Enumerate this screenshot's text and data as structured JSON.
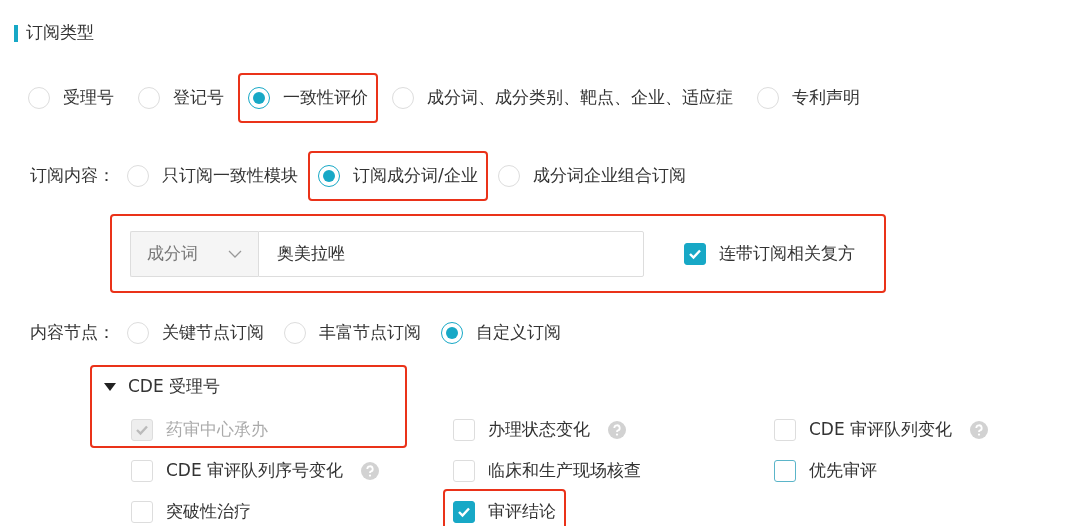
{
  "section_title": "订阅类型",
  "subscription_types": [
    {
      "label": "受理号",
      "selected": false,
      "highlighted": false
    },
    {
      "label": "登记号",
      "selected": false,
      "highlighted": false
    },
    {
      "label": "一致性评价",
      "selected": true,
      "highlighted": true
    },
    {
      "label": "成分词、成分类别、靶点、企业、适应症",
      "selected": false,
      "highlighted": false
    },
    {
      "label": "专利声明",
      "selected": false,
      "highlighted": false
    }
  ],
  "content": {
    "label": "订阅内容：",
    "options": [
      {
        "label": "只订阅一致性模块",
        "selected": false,
        "highlighted": false
      },
      {
        "label": "订阅成分词/企业",
        "selected": true,
        "highlighted": true
      },
      {
        "label": "成分词企业组合订阅",
        "selected": false,
        "highlighted": false
      }
    ]
  },
  "filter": {
    "highlighted": true,
    "field_type": "成分词",
    "value": "奥美拉唑",
    "include_compounds": {
      "label": "连带订阅相关复方",
      "checked": true
    }
  },
  "nodes": {
    "label": "内容节点：",
    "options": [
      {
        "label": "关键节点订阅",
        "selected": false
      },
      {
        "label": "丰富节点订阅",
        "selected": false
      },
      {
        "label": "自定义订阅",
        "selected": true
      }
    ]
  },
  "tree": {
    "label": "CDE 受理号",
    "expanded": true,
    "highlighted": true,
    "children": [
      {
        "label": "药审中心承办",
        "checked": true,
        "disabled": true,
        "help": false,
        "focused": false,
        "highlighted": false
      },
      {
        "label": "办理状态变化",
        "checked": false,
        "disabled": false,
        "help": true,
        "focused": false,
        "highlighted": false
      },
      {
        "label": "CDE 审评队列变化",
        "checked": false,
        "disabled": false,
        "help": true,
        "focused": false,
        "highlighted": false
      },
      {
        "label": "CDE 审评队列序号变化",
        "checked": false,
        "disabled": false,
        "help": true,
        "focused": false,
        "highlighted": false
      },
      {
        "label": "临床和生产现场核查",
        "checked": false,
        "disabled": false,
        "help": false,
        "focused": false,
        "highlighted": false
      },
      {
        "label": "优先审评",
        "checked": false,
        "disabled": false,
        "help": false,
        "focused": true,
        "highlighted": false
      },
      {
        "label": "突破性治疗",
        "checked": false,
        "disabled": false,
        "help": false,
        "focused": false,
        "highlighted": false
      },
      {
        "label": "审评结论",
        "checked": true,
        "disabled": false,
        "help": false,
        "focused": false,
        "highlighted": true
      }
    ]
  }
}
